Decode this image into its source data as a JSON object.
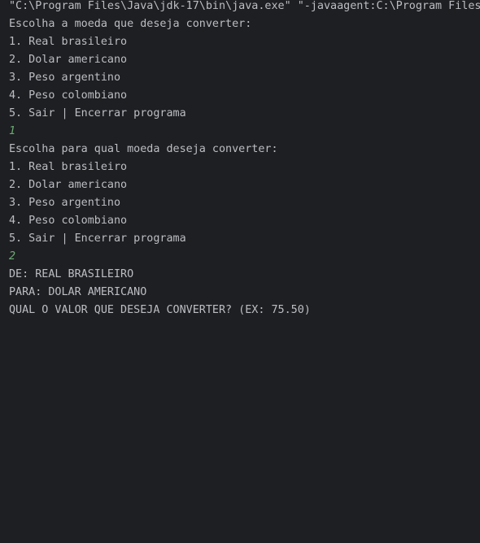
{
  "console": {
    "command_line": "\"C:\\Program Files\\Java\\jdk-17\\bin\\java.exe\" \"-javaagent:C:\\Program Files\\",
    "prompt_from": "Escolha a moeda que deseja converter:",
    "options_from": [
      "1. Real brasileiro",
      "2. Dolar americano",
      "3. Peso argentino",
      "4. Peso colombiano",
      "5. Sair | Encerrar programa"
    ],
    "input_from": "1",
    "prompt_to": "Escolha para qual moeda deseja converter:",
    "options_to": [
      "1. Real brasileiro",
      "2. Dolar americano",
      "3. Peso argentino",
      "4. Peso colombiano",
      "5. Sair | Encerrar programa"
    ],
    "input_to": "2",
    "summary_from": "DE: REAL BRASILEIRO",
    "summary_to": "PARA: DOLAR AMERICANO",
    "value_prompt": "QUAL O VALOR QUE DESEJA CONVERTER? (EX: 75.50)"
  },
  "colors": {
    "background": "#1e1f22",
    "text": "#bcbec4",
    "user_input": "#6aab73"
  }
}
